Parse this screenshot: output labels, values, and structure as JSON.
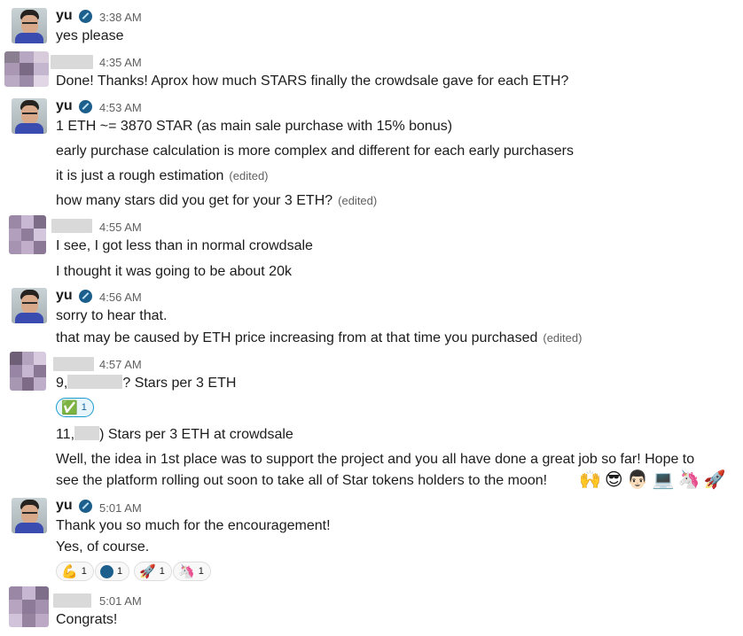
{
  "messages": [
    {
      "sender": "yu",
      "time": "3:38 AM",
      "lines": [
        "yes please"
      ]
    },
    {
      "sender": "",
      "time": "4:35 AM",
      "lines": [
        "Done! Thanks! Aprox how much STARS finally the crowdsale gave for each ETH?"
      ]
    },
    {
      "sender": "yu",
      "time": "4:53 AM",
      "lines": [
        "1 ETH ~= 3870 STAR (as main sale purchase with 15% bonus)",
        "early purchase calculation is more complex and different for each early purchasers",
        "it is just a rough estimation",
        "how many stars did you get for your 3 ETH?"
      ]
    },
    {
      "sender": "",
      "time": "4:55 AM",
      "lines": [
        "I see, I got less than in normal crowdsale",
        "I thought it was going to be about 20k"
      ]
    },
    {
      "sender": "yu",
      "time": "4:56 AM",
      "lines": [
        "sorry to hear that.",
        "that may be caused by ETH price increasing from at that time you purchased"
      ]
    },
    {
      "sender": "",
      "time": "4:57 AM",
      "lines": [
        "9,",
        "? Stars per 3 ETH",
        "11,",
        ") Stars per 3 ETH at crowdsale",
        "Well, the idea in 1st place was to support the project and you all have done a great job so far! Hope to",
        "see the platform rolling out soon to take all of Star tokens holders to the moon!"
      ]
    },
    {
      "sender": "yu",
      "time": "5:01 AM",
      "lines": [
        "Thank you so much for the encouragement!",
        "Yes, of course."
      ]
    },
    {
      "sender": "",
      "time": "5:01 AM",
      "lines": [
        "Congrats!"
      ]
    }
  ],
  "edited_label": "(edited)",
  "reactions_1": [
    {
      "emoji": "✅",
      "count": "1"
    }
  ],
  "reactions_2": [
    {
      "emoji": "💪",
      "count": "1"
    },
    {
      "emoji": "star-logo",
      "count": "1"
    },
    {
      "emoji": "🚀",
      "count": "1"
    },
    {
      "emoji": "🦄",
      "count": "1"
    }
  ],
  "inline_emojis": [
    "🙌",
    "😎",
    "👨🏻",
    "💻",
    "🦄",
    "🚀"
  ],
  "colors": {
    "text": "#1d1c1d",
    "muted": "#616061",
    "link_blue": "#1264a3",
    "badge": "#1d5f8c"
  }
}
